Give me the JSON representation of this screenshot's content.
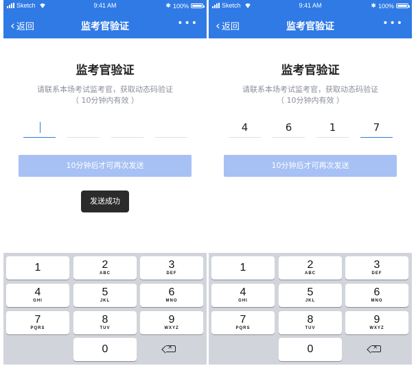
{
  "status": {
    "carrier": "Sketch",
    "time": "9:41 AM",
    "battery": "100%"
  },
  "nav": {
    "back_label": "返回",
    "title": "监考官验证",
    "more": "•••"
  },
  "content": {
    "title": "监考官验证",
    "subtitle_line1": "请联系本场考试监考官，获取动态码验证",
    "subtitle_line2": "（ 10分钟内有效 ）",
    "resend_label": "10分钟后才可再次发送",
    "toast": "发送成功"
  },
  "left_code": [
    "",
    "",
    "",
    ""
  ],
  "right_code": [
    "4",
    "6",
    "1",
    "7"
  ],
  "keypad": {
    "k1": {
      "digit": "1",
      "letters": ""
    },
    "k2": {
      "digit": "2",
      "letters": "ABC"
    },
    "k3": {
      "digit": "3",
      "letters": "DEF"
    },
    "k4": {
      "digit": "4",
      "letters": "GHI"
    },
    "k5": {
      "digit": "5",
      "letters": "JKL"
    },
    "k6": {
      "digit": "6",
      "letters": "MNO"
    },
    "k7": {
      "digit": "7",
      "letters": "PQRS"
    },
    "k8": {
      "digit": "8",
      "letters": "TUV"
    },
    "k9": {
      "digit": "9",
      "letters": "WXYZ"
    },
    "k0": {
      "digit": "0",
      "letters": ""
    }
  },
  "icons": {
    "back": "chevron-left-icon",
    "more": "more-dots-icon",
    "delete": "backspace-icon"
  },
  "colors": {
    "primary": "#2f7ae5",
    "button_disabled": "#a7c1f4",
    "toast_bg": "#2b2b2b",
    "keyboard_bg": "#d1d5db"
  }
}
